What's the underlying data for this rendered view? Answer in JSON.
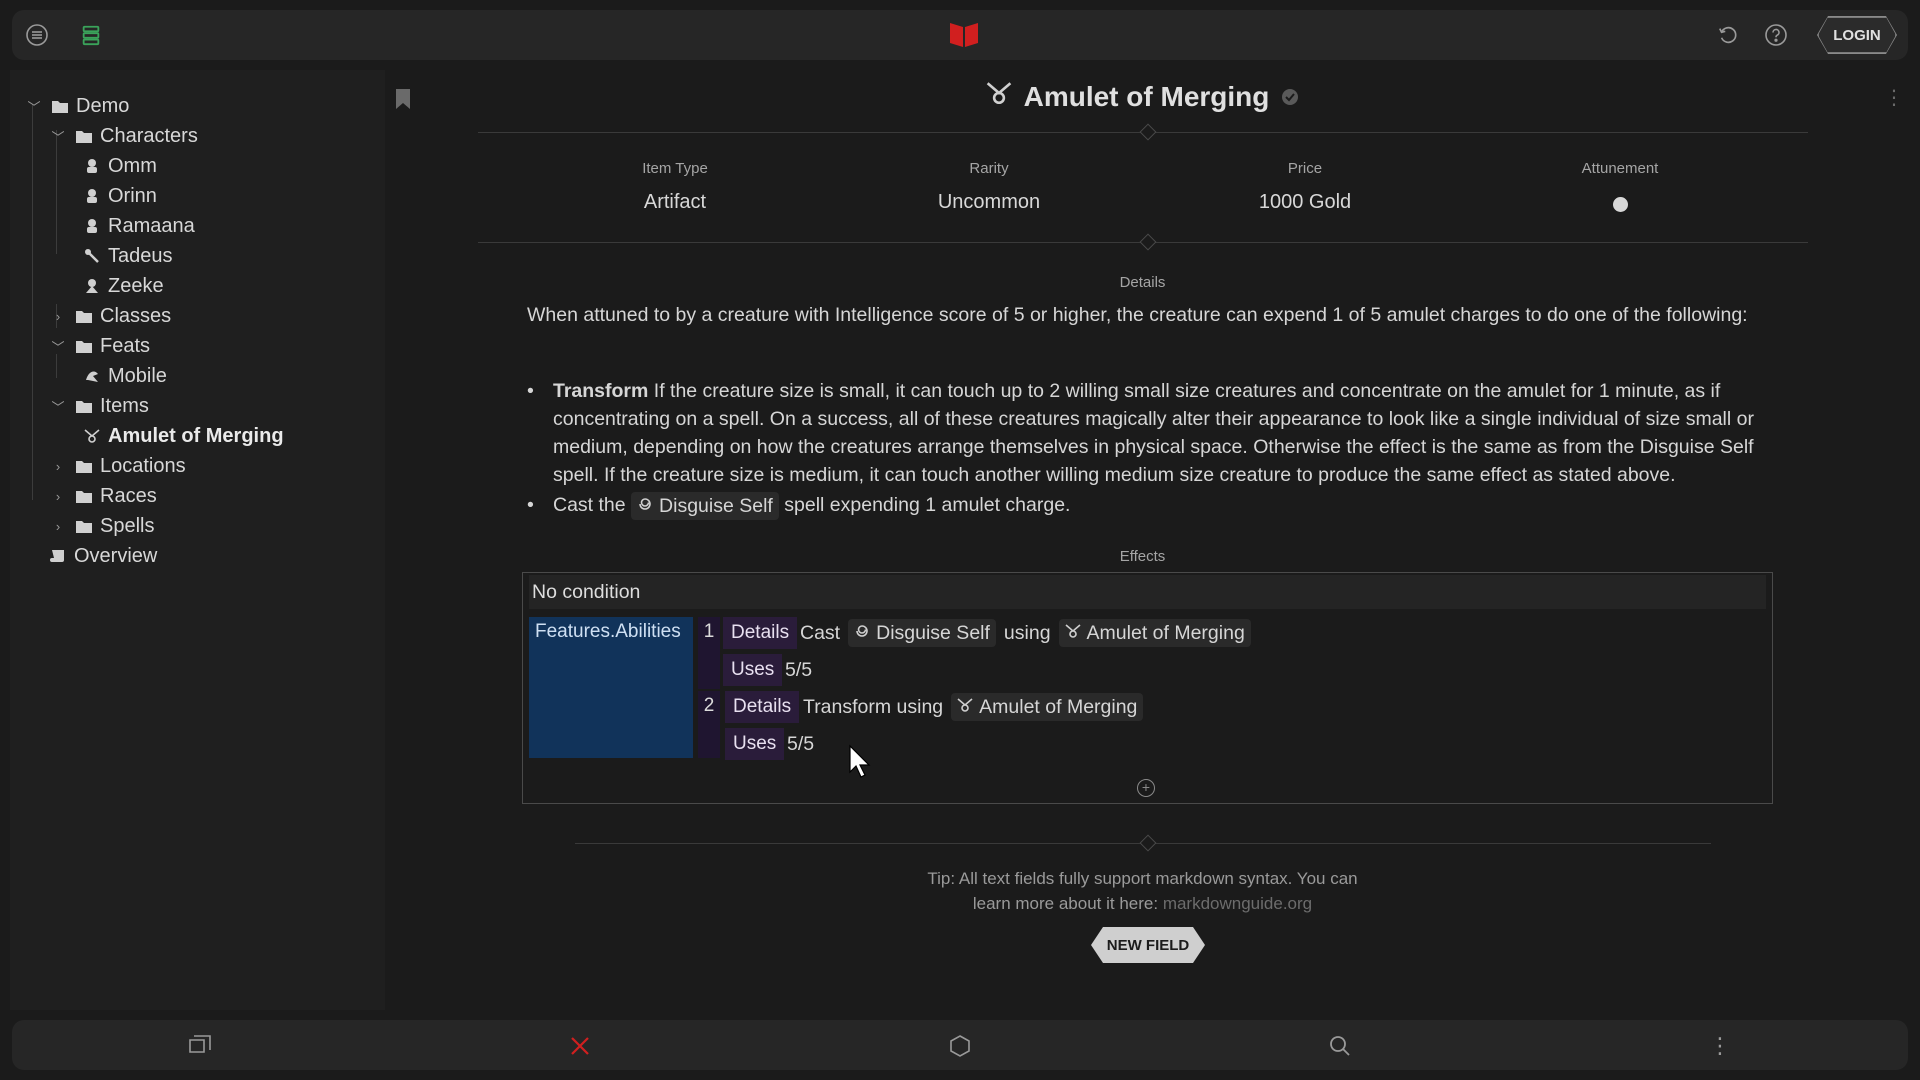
{
  "topbar": {
    "menu_icon": "list-circle-icon",
    "stack_icon": "stack-icon",
    "logo_icon": "red-book-icon",
    "undo_icon": "undo-icon",
    "help_icon": "help-icon",
    "login_label": "LOGIN",
    "logo_color": "#d11f1f",
    "stack_color": "#3aa35a"
  },
  "sidebar": {
    "items": [
      {
        "label": "Demo",
        "icon": "folder-icon"
      },
      {
        "label": "Characters",
        "icon": "folder-icon"
      },
      {
        "label": "Omm",
        "icon": "character-icon"
      },
      {
        "label": "Orinn",
        "icon": "character-icon"
      },
      {
        "label": "Ramaana",
        "icon": "character-icon"
      },
      {
        "label": "Tadeus",
        "icon": "character-icon"
      },
      {
        "label": "Zeeke",
        "icon": "character-icon"
      },
      {
        "label": "Classes",
        "icon": "folder-icon"
      },
      {
        "label": "Feats",
        "icon": "folder-icon"
      },
      {
        "label": "Mobile",
        "icon": "feat-icon"
      },
      {
        "label": "Items",
        "icon": "folder-icon"
      },
      {
        "label": "Amulet of Merging",
        "icon": "amulet-icon"
      },
      {
        "label": "Locations",
        "icon": "folder-icon"
      },
      {
        "label": "Races",
        "icon": "folder-icon"
      },
      {
        "label": "Spells",
        "icon": "folder-icon"
      },
      {
        "label": "Overview",
        "icon": "scroll-icon"
      }
    ]
  },
  "page": {
    "title": "Amulet of Merging",
    "props": [
      {
        "label": "Item Type",
        "value": "Artifact"
      },
      {
        "label": "Rarity",
        "value": "Uncommon"
      },
      {
        "label": "Price",
        "value": "1000 Gold"
      },
      {
        "label": "Attunement",
        "value": ""
      }
    ],
    "details_label": "Details",
    "details_intro": "When attuned to by a creature with Intelligence score of 5 or higher, the creature can expend 1 of 5 amulet charges to do one of the following:",
    "bullet1_bold": "Transform",
    "bullet1_text": " If the creature size is small, it can touch up to 2 willing small size creatures and concentrate on the amulet for 1 minute, as if concentrating on a spell. On a success, all of these creatures magically alter their appearance to look like a single individual of size small or medium, depending on how the creatures arrange themselves in physical space. Otherwise the effect is the same as from the Disguise Self spell. If the creature size is medium, it can touch another willing medium size creature to produce the same effect as stated above.",
    "bullet2_pre": "Cast the",
    "bullet2_chip": "Disguise Self",
    "bullet2_post": "spell expending 1 amulet charge.",
    "effects_label": "Effects",
    "effects": {
      "condition": "No condition",
      "feature": "Features.Abilities",
      "e1_num": "1",
      "e1_tag": "Details",
      "e1_cast": "Cast",
      "e1_spell": "Disguise Self",
      "e1_using": "using",
      "e1_item": "Amulet of Merging",
      "e1_uses_tag": "Uses",
      "e1_uses": "5/5",
      "e2_num": "2",
      "e2_tag": "Details",
      "e2_text": "Transform using",
      "e2_item": "Amulet of Merging",
      "e2_uses_tag": "Uses",
      "e2_uses": "5/5"
    },
    "tip_line1": "Tip: All text fields fully support markdown syntax. You can",
    "tip_line2": "learn more about it here:",
    "tip_link": "markdownguide.org",
    "new_field_label": "NEW FIELD"
  },
  "bottombar": {
    "icons": [
      "swap-icon",
      "close-icon",
      "hexagon-icon",
      "search-icon",
      "more-vertical-icon"
    ],
    "close_color": "#d11f1f"
  }
}
